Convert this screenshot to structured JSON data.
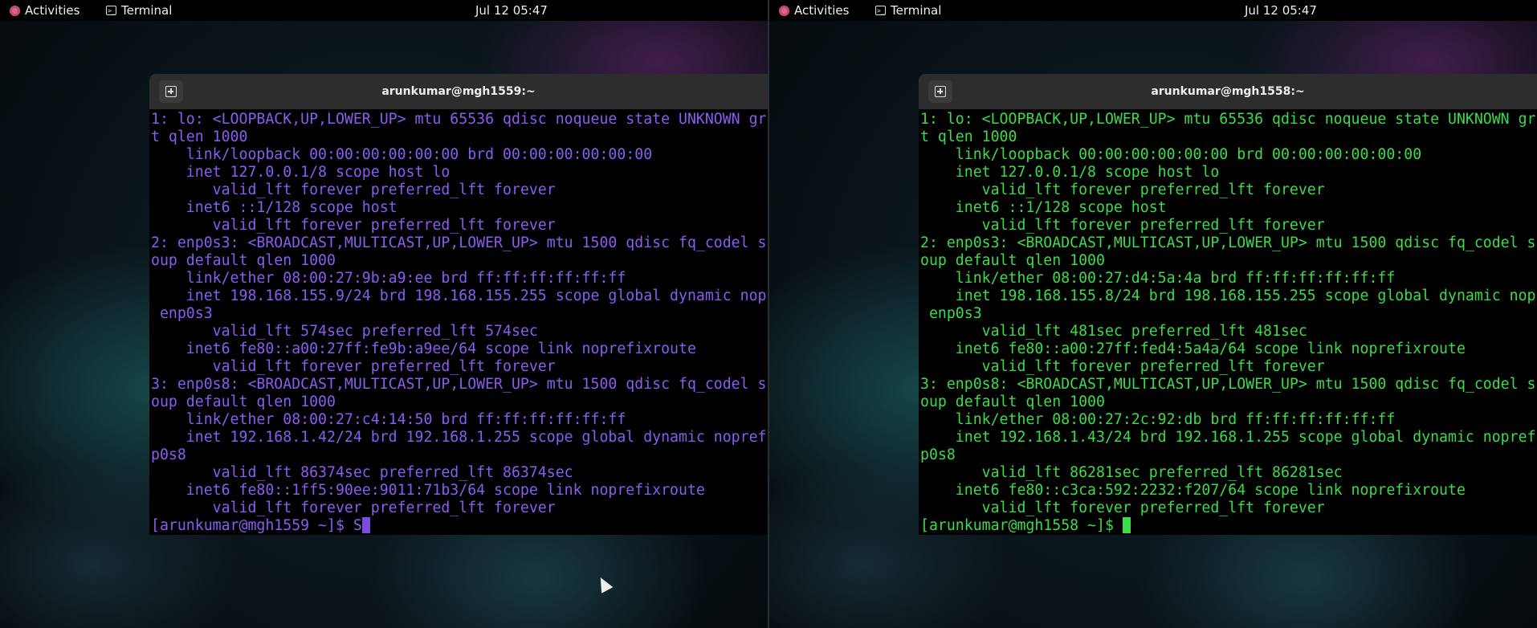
{
  "topbar": {
    "activities_label": "Activities",
    "app_label": "Terminal",
    "clock": "Jul 12  05:47"
  },
  "colors": {
    "left_terminal_fg": "#8a5cf0",
    "right_terminal_fg": "#3ddb4a",
    "titlebar_bg": "#2d2d2d"
  },
  "left": {
    "title": "arunkumar@mgh1559:~",
    "lines": [
      "1: lo: <LOOPBACK,UP,LOWER_UP> mtu 65536 qdisc noqueue state UNKNOWN gr",
      "t qlen 1000",
      "    link/loopback 00:00:00:00:00:00 brd 00:00:00:00:00:00",
      "    inet 127.0.0.1/8 scope host lo",
      "       valid_lft forever preferred_lft forever",
      "    inet6 ::1/128 scope host",
      "       valid_lft forever preferred_lft forever",
      "2: enp0s3: <BROADCAST,MULTICAST,UP,LOWER_UP> mtu 1500 qdisc fq_codel s",
      "oup default qlen 1000",
      "    link/ether 08:00:27:9b:a9:ee brd ff:ff:ff:ff:ff:ff",
      "    inet 198.168.155.9/24 brd 198.168.155.255 scope global dynamic nop",
      " enp0s3",
      "       valid_lft 574sec preferred_lft 574sec",
      "    inet6 fe80::a00:27ff:fe9b:a9ee/64 scope link noprefixroute",
      "       valid_lft forever preferred_lft forever",
      "3: enp0s8: <BROADCAST,MULTICAST,UP,LOWER_UP> mtu 1500 qdisc fq_codel s",
      "oup default qlen 1000",
      "    link/ether 08:00:27:c4:14:50 brd ff:ff:ff:ff:ff:ff",
      "    inet 192.168.1.42/24 brd 192.168.1.255 scope global dynamic nopref",
      "p0s8",
      "       valid_lft 86374sec preferred_lft 86374sec",
      "    inet6 fe80::1ff5:90ee:9011:71b3/64 scope link noprefixroute",
      "       valid_lft forever preferred_lft forever"
    ],
    "prompt": "[arunkumar@mgh1559 ~]$ S"
  },
  "right": {
    "title": "arunkumar@mgh1558:~",
    "lines": [
      "1: lo: <LOOPBACK,UP,LOWER_UP> mtu 65536 qdisc noqueue state UNKNOWN gr",
      "t qlen 1000",
      "    link/loopback 00:00:00:00:00:00 brd 00:00:00:00:00:00",
      "    inet 127.0.0.1/8 scope host lo",
      "       valid_lft forever preferred_lft forever",
      "    inet6 ::1/128 scope host",
      "       valid_lft forever preferred_lft forever",
      "2: enp0s3: <BROADCAST,MULTICAST,UP,LOWER_UP> mtu 1500 qdisc fq_codel s",
      "oup default qlen 1000",
      "    link/ether 08:00:27:d4:5a:4a brd ff:ff:ff:ff:ff:ff",
      "    inet 198.168.155.8/24 brd 198.168.155.255 scope global dynamic nop",
      " enp0s3",
      "       valid_lft 481sec preferred_lft 481sec",
      "    inet6 fe80::a00:27ff:fed4:5a4a/64 scope link noprefixroute",
      "       valid_lft forever preferred_lft forever",
      "3: enp0s8: <BROADCAST,MULTICAST,UP,LOWER_UP> mtu 1500 qdisc fq_codel s",
      "oup default qlen 1000",
      "    link/ether 08:00:27:2c:92:db brd ff:ff:ff:ff:ff:ff",
      "    inet 192.168.1.43/24 brd 192.168.1.255 scope global dynamic nopref",
      "p0s8",
      "       valid_lft 86281sec preferred_lft 86281sec",
      "    inet6 fe80::c3ca:592:2232:f207/64 scope link noprefixroute",
      "       valid_lft forever preferred_lft forever"
    ],
    "prompt": "[arunkumar@mgh1558 ~]$ "
  }
}
